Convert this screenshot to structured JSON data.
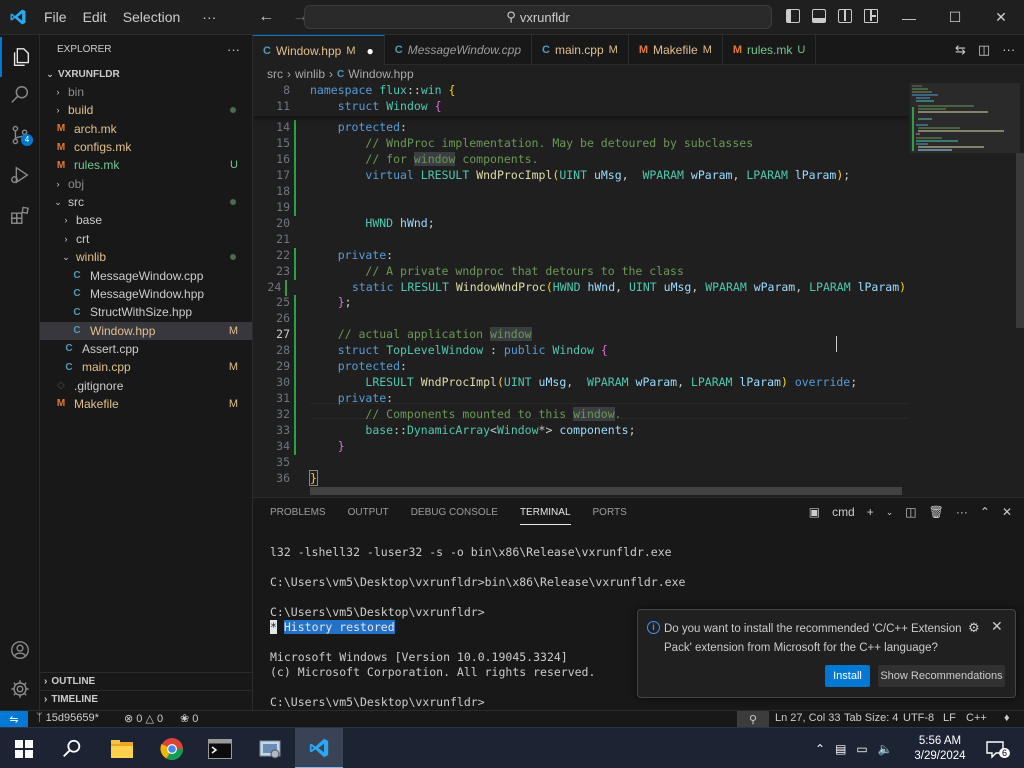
{
  "titlebar": {
    "menu": [
      "File",
      "Edit",
      "Selection"
    ],
    "more": "···",
    "search_text": "vxrunfldr"
  },
  "activity": {
    "source_control_badge": "4"
  },
  "explorer": {
    "title": "EXPLORER",
    "more": "···",
    "root": "VXRUNFLDR",
    "items": [
      {
        "label": "bin",
        "kind": "folder",
        "indent": 1,
        "open": false,
        "status": "",
        "color": "ignored"
      },
      {
        "label": "build",
        "kind": "folder",
        "indent": 1,
        "open": false,
        "status": "dot",
        "color": "mod"
      },
      {
        "label": "arch.mk",
        "kind": "mk",
        "indent": 1,
        "status": "",
        "color": "mod"
      },
      {
        "label": "configs.mk",
        "kind": "mk",
        "indent": 1,
        "status": "",
        "color": "mod"
      },
      {
        "label": "rules.mk",
        "kind": "mk",
        "indent": 1,
        "status": "U",
        "color": "untracked"
      },
      {
        "label": "obj",
        "kind": "folder",
        "indent": 1,
        "open": false,
        "status": "",
        "color": "ignored"
      },
      {
        "label": "src",
        "kind": "folder",
        "indent": 1,
        "open": true,
        "status": "dot",
        "color": "plain"
      },
      {
        "label": "base",
        "kind": "folder",
        "indent": 2,
        "open": false,
        "status": "",
        "color": "plain"
      },
      {
        "label": "crt",
        "kind": "folder",
        "indent": 2,
        "open": false,
        "status": "",
        "color": "plain"
      },
      {
        "label": "winlib",
        "kind": "folder",
        "indent": 2,
        "open": true,
        "status": "dot",
        "color": "mod"
      },
      {
        "label": "MessageWindow.cpp",
        "kind": "cpp",
        "indent": 3,
        "status": "",
        "color": "plain"
      },
      {
        "label": "MessageWindow.hpp",
        "kind": "cpp",
        "indent": 3,
        "status": "",
        "color": "plain"
      },
      {
        "label": "StructWithSize.hpp",
        "kind": "cpp",
        "indent": 3,
        "status": "",
        "color": "plain"
      },
      {
        "label": "Window.hpp",
        "kind": "cpp",
        "indent": 3,
        "status": "M",
        "color": "mod",
        "selected": true
      },
      {
        "label": "Assert.cpp",
        "kind": "cpp",
        "indent": 2,
        "status": "",
        "color": "plain"
      },
      {
        "label": "main.cpp",
        "kind": "cpp",
        "indent": 2,
        "status": "M",
        "color": "mod"
      },
      {
        "label": ".gitignore",
        "kind": "git",
        "indent": 1,
        "status": "",
        "color": "plain"
      },
      {
        "label": "Makefile",
        "kind": "make",
        "indent": 1,
        "status": "M",
        "color": "mod"
      }
    ],
    "outline": "OUTLINE",
    "timeline": "TIMELINE"
  },
  "tabs": [
    {
      "label": "Window.hpp",
      "status": "M",
      "dirty": true,
      "icon": "C",
      "active": true
    },
    {
      "label": "MessageWindow.cpp",
      "status": "",
      "dirty": false,
      "icon": "C",
      "active": false,
      "italic": true
    },
    {
      "label": "main.cpp",
      "status": "M",
      "dirty": false,
      "icon": "C",
      "active": false
    },
    {
      "label": "Makefile",
      "status": "M",
      "dirty": false,
      "icon": "M",
      "active": false
    },
    {
      "label": "rules.mk",
      "status": "U",
      "dirty": false,
      "icon": "M",
      "active": false
    }
  ],
  "breadcrumb": [
    "src",
    "winlib",
    "Window.hpp"
  ],
  "code": {
    "sticky": [
      {
        "n": "8",
        "html": "<span class='kw'>namespace</span> <span class='ty'>flux</span>::<span class='ty'>win</span> <span class='br'>{</span>"
      },
      {
        "n": "11",
        "html": "    <span class='kw'>struct</span> <span class='ty'>Window</span> <span class='br2'>{</span>"
      }
    ],
    "lines": [
      {
        "n": "14",
        "git": true,
        "html": "    <span class='kw'>protected</span>:"
      },
      {
        "n": "15",
        "git": true,
        "html": "        <span class='cm'>// WndProc implementation. May be detoured by subclasses</span>"
      },
      {
        "n": "16",
        "git": true,
        "html": "        <span class='cm'>// for <span class='hl'>window</span> components.</span>"
      },
      {
        "n": "17",
        "git": true,
        "html": "        <span class='kw'>virtual</span> <span class='ty'>LRESULT</span> <span class='fn'>WndProcImpl</span><span class='br'>(</span><span class='ty'>UINT</span> <span class='pa'>uMsg</span>,  <span class='ty'>WPARAM</span> <span class='pa'>wParam</span>, <span class='ty'>LPARAM</span> <span class='pa'>lParam</span><span class='br'>)</span>;"
      },
      {
        "n": "18",
        "git": true,
        "html": ""
      },
      {
        "n": "19",
        "git": true,
        "html": ""
      },
      {
        "n": "20",
        "git": false,
        "html": "        <span class='ty'>HWND</span> <span class='pa'>hWnd</span>;"
      },
      {
        "n": "21",
        "git": false,
        "html": ""
      },
      {
        "n": "22",
        "git": true,
        "html": "    <span class='kw'>private</span>:"
      },
      {
        "n": "23",
        "git": true,
        "html": "        <span class='cm'>// A private wndproc that detours to the class</span>"
      },
      {
        "n": "24",
        "git": true,
        "html": "        <span class='kw'>static</span> <span class='ty'>LRESULT</span> <span class='fn'>WindowWndProc</span><span class='br'>(</span><span class='ty'>HWND</span> <span class='pa'>hWnd</span>, <span class='ty'>UINT</span> <span class='pa'>uMsg</span>, <span class='ty'>WPARAM</span> <span class='pa'>wParam</span>, <span class='ty'>LPARAM</span> <span class='pa'>lParam</span><span class='br'>)</span>;"
      },
      {
        "n": "25",
        "git": true,
        "html": "    <span class='br2'>}</span>;"
      },
      {
        "n": "26",
        "git": true,
        "html": ""
      },
      {
        "n": "27",
        "git": true,
        "cur": true,
        "html": "    <span class='cm'>// actual application <span class='hl'>window</span></span>"
      },
      {
        "n": "28",
        "git": true,
        "html": "    <span class='kw'>struct</span> <span class='ty'>TopLevelWindow</span> : <span class='kw'>public</span> <span class='ty'>Window</span> <span class='br2'>{</span>"
      },
      {
        "n": "29",
        "git": true,
        "html": "    <span class='kw'>protected</span>:"
      },
      {
        "n": "30",
        "git": true,
        "html": "        <span class='ty'>LRESULT</span> <span class='fn'>WndProcImpl</span><span class='br'>(</span><span class='ty'>UINT</span> <span class='pa'>uMsg</span>,  <span class='ty'>WPARAM</span> <span class='pa'>wParam</span>, <span class='ty'>LPARAM</span> <span class='pa'>lParam</span><span class='br'>)</span> <span class='kw'>override</span>;"
      },
      {
        "n": "31",
        "git": true,
        "html": "    <span class='kw'>private</span>:"
      },
      {
        "n": "32",
        "git": true,
        "html": "        <span class='cm'>// Components mounted to this <span class='hl'>window</span>.</span>"
      },
      {
        "n": "33",
        "git": true,
        "html": "        <span class='ty'>base</span>::<span class='ty'>DynamicArray</span>&lt;<span class='ty'>Window</span>*&gt; <span class='pa'>components</span>;"
      },
      {
        "n": "34",
        "git": true,
        "html": "    <span class='br2'>}</span>"
      },
      {
        "n": "35",
        "git": false,
        "html": ""
      },
      {
        "n": "36",
        "git": false,
        "html": "<span class='br' style='outline:1px solid #888'>}</span>"
      },
      {
        "n": "37",
        "git": false,
        "html": ""
      }
    ]
  },
  "panel": {
    "tabs": [
      "PROBLEMS",
      "OUTPUT",
      "DEBUG CONSOLE",
      "TERMINAL",
      "PORTS"
    ],
    "active_tab": "TERMINAL",
    "shell": "cmd",
    "terminal": [
      "l32 -lshell32 -luser32 -s -o bin\\x86\\Release\\vxrunfldr.exe",
      "",
      "C:\\Users\\vm5\\Desktop\\vxrunfldr>bin\\x86\\Release\\vxrunfldr.exe",
      "",
      "C:\\Users\\vm5\\Desktop\\vxrunfldr>",
      "",
      "",
      "Microsoft Windows [Version 10.0.19045.3324]",
      "(c) Microsoft Corporation. All rights reserved.",
      "",
      "C:\\Users\\vm5\\Desktop\\vxrunfldr>"
    ],
    "restored_star": "*",
    "restored_text": "History restored"
  },
  "toast": {
    "message": "Do you want to install the recommended 'C/C++ Extension Pack' extension from Microsoft for the C++ language?",
    "install": "Install",
    "show": "Show Recommendations"
  },
  "status": {
    "branch": "15d95659*",
    "errors": "0",
    "warnings": "0",
    "ports": "0",
    "position": "Ln 27, Col 33",
    "tabsize": "Tab Size: 4",
    "encoding": "UTF-8",
    "eol": "LF",
    "language": "C++"
  },
  "taskbar": {
    "time": "5:56 AM",
    "date": "3/29/2024",
    "notif_count": "6"
  }
}
